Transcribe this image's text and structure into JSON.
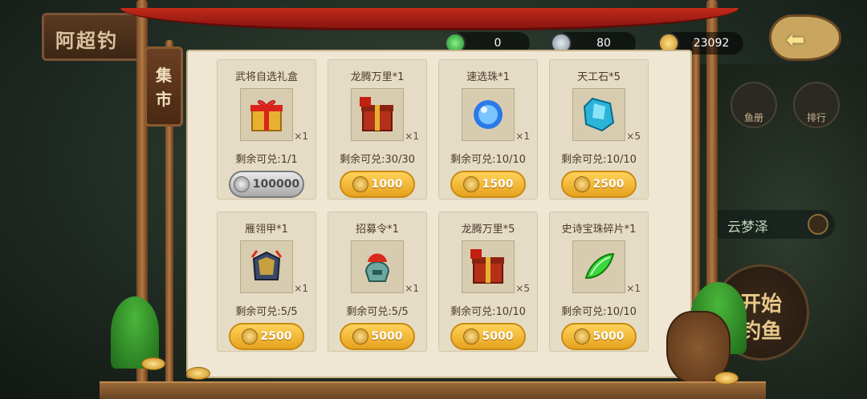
{
  "background": {
    "left_sign_text": "阿超钓",
    "location_name": "云梦泽",
    "start_button_text": "开始\n钓鱼",
    "side_buttons": [
      "鱼册",
      "排行"
    ]
  },
  "resources": {
    "green_gem": "0",
    "silver_coin": "80",
    "gold_coin": "23092"
  },
  "market_title": "集市",
  "items": [
    {
      "name": "武将自选礼盒",
      "qty": "×1",
      "remain": "剩余可兑:1/1",
      "price": "100000",
      "currency": "silver",
      "icon": "gift-box-icon"
    },
    {
      "name": "龙腾万里*1",
      "qty": "×1",
      "remain": "剩余可兑:30/30",
      "price": "1000",
      "currency": "gold",
      "icon": "chest-icon"
    },
    {
      "name": "速选珠*1",
      "qty": "×1",
      "remain": "剩余可兑:10/10",
      "price": "1500",
      "currency": "gold",
      "icon": "blue-orb-icon"
    },
    {
      "name": "天工石*5",
      "qty": "×5",
      "remain": "剩余可兑:10/10",
      "price": "2500",
      "currency": "gold",
      "icon": "crystal-icon"
    },
    {
      "name": "雁翎甲*1",
      "qty": "×1",
      "remain": "剩余可兑:5/5",
      "price": "2500",
      "currency": "gold",
      "icon": "armor-icon"
    },
    {
      "name": "招募令*1",
      "qty": "×1",
      "remain": "剩余可兑:5/5",
      "price": "5000",
      "currency": "gold",
      "icon": "helmet-icon"
    },
    {
      "name": "龙腾万里*5",
      "qty": "×5",
      "remain": "剩余可兑:10/10",
      "price": "5000",
      "currency": "gold",
      "icon": "chest-icon"
    },
    {
      "name": "史诗宝珠碎片*1",
      "qty": "×1",
      "remain": "剩余可兑:10/10",
      "price": "5000",
      "currency": "gold",
      "icon": "green-shard-icon"
    }
  ]
}
